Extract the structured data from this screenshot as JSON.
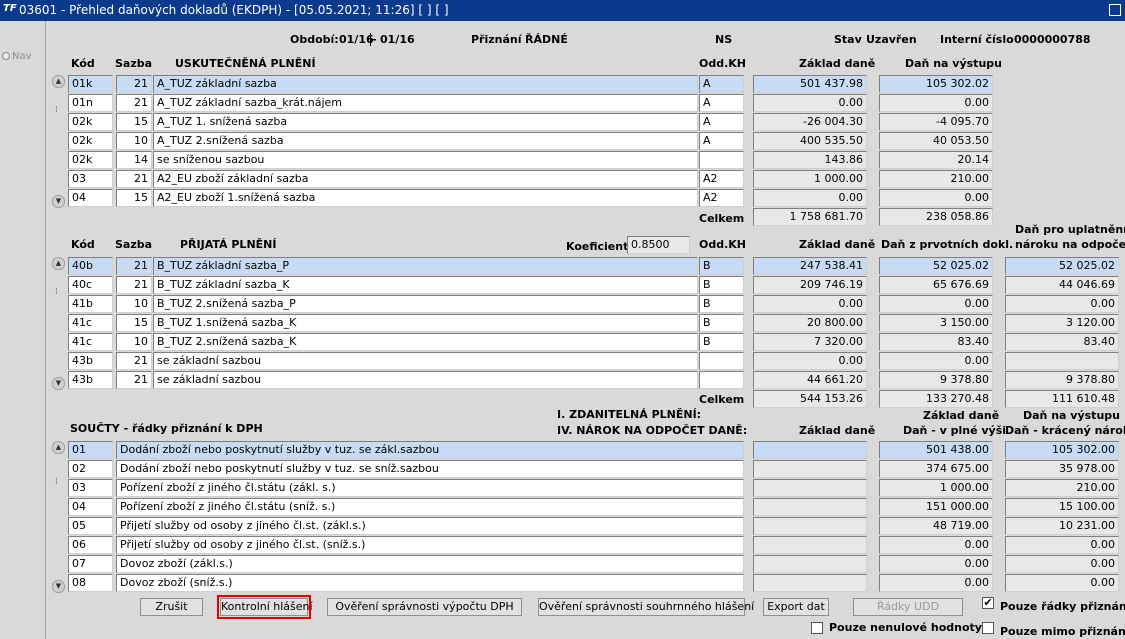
{
  "window": {
    "title": "03601 - Přehled daňových dokladů (EKDPH) - [05.05.2021; 11:26]  [ ]  [ ]",
    "logo": "TF"
  },
  "nav": {
    "label": "Nav"
  },
  "header": {
    "period_label": "Období:",
    "period_from": "01/16",
    "period_sep": "-",
    "period_to": "01/16",
    "filing_label": "Přiznání",
    "filing_value": "ŘÁDNÉ",
    "ns_label": "NS",
    "state_label": "Stav",
    "state_value": "Uzavřen",
    "internal_label": "Interní číslo",
    "internal_value": "0000000788"
  },
  "section1": {
    "col_kod": "Kód",
    "col_sazba": "Sazba",
    "col_name": "USKUTEČNĚNÁ PLNĚNÍ",
    "col_kh": "Odd.KH",
    "col_base": "Základ daně",
    "col_tax": "Daň na výstupu",
    "rows": [
      {
        "kod": "01k",
        "sazba": "21",
        "name": "A_TUZ základní sazba",
        "kh": "A",
        "base": "501 437.98",
        "tax": "105 302.02"
      },
      {
        "kod": "01n",
        "sazba": "21",
        "name": "A_TUZ základní sazba_krát.nájem",
        "kh": "A",
        "base": "0.00",
        "tax": "0.00"
      },
      {
        "kod": "02k",
        "sazba": "15",
        "name": "A_TUZ 1. snížená sazba",
        "kh": "A",
        "base": "-26 004.30",
        "tax": "-4 095.70"
      },
      {
        "kod": "02k",
        "sazba": "10",
        "name": "A_TUZ 2.snížená sazba",
        "kh": "A",
        "base": "400 535.50",
        "tax": "40 053.50"
      },
      {
        "kod": "02k",
        "sazba": "14",
        "name": "se sníženou sazbou",
        "kh": "",
        "base": "143.86",
        "tax": "20.14"
      },
      {
        "kod": "03",
        "sazba": "21",
        "name": "A2_EU zboží základní sazba",
        "kh": "A2",
        "base": "1 000.00",
        "tax": "210.00"
      },
      {
        "kod": "04",
        "sazba": "15",
        "name": "A2_EU zboží 1.snížená sazba",
        "kh": "A2",
        "base": "0.00",
        "tax": "0.00"
      }
    ],
    "total_label": "Celkem",
    "total_base": "1 758 681.70",
    "total_tax": "238 058.86"
  },
  "section2": {
    "col_kod": "Kód",
    "col_sazba": "Sazba",
    "col_name": "PŘIJATÁ PLNĚNÍ",
    "coef_label": "Koeficient",
    "coef_value": "0.8500",
    "col_kh": "Odd.KH",
    "col_base": "Základ daně",
    "col_tax": "Daň z prvotních dokl.",
    "col_claim_1": "Daň pro uplatnění",
    "col_claim_2": "nároku na odpočet",
    "rows": [
      {
        "kod": "40b",
        "sazba": "21",
        "name": "B_TUZ základní sazba_P",
        "kh": "B",
        "base": "247 538.41",
        "tax": "52 025.02",
        "claim": "52 025.02"
      },
      {
        "kod": "40c",
        "sazba": "21",
        "name": "B_TUZ základní sazba_K",
        "kh": "B",
        "base": "209 746.19",
        "tax": "65 676.69",
        "claim": "44 046.69"
      },
      {
        "kod": "41b",
        "sazba": "10",
        "name": "B_TUZ 2.snížená sazba_P",
        "kh": "B",
        "base": "0.00",
        "tax": "0.00",
        "claim": "0.00"
      },
      {
        "kod": "41c",
        "sazba": "15",
        "name": "B_TUZ 1.snížená sazba_K",
        "kh": "B",
        "base": "20 800.00",
        "tax": "3 150.00",
        "claim": "3 120.00"
      },
      {
        "kod": "41c",
        "sazba": "10",
        "name": "B_TUZ 2.snížená sazba_K",
        "kh": "B",
        "base": "7 320.00",
        "tax": "83.40",
        "claim": "83.40"
      },
      {
        "kod": "43b",
        "sazba": "21",
        "name": "se základní sazbou",
        "kh": "",
        "base": "0.00",
        "tax": "0.00",
        "claim": ""
      },
      {
        "kod": "43b",
        "sazba": "21",
        "name": "se základní sazbou",
        "kh": "",
        "base": "44 661.20",
        "tax": "9 378.80",
        "claim": "9 378.80"
      }
    ],
    "total_label": "Celkem",
    "total_base": "544 153.26",
    "total_tax": "133 270.48",
    "total_claim": "111 610.48"
  },
  "section3": {
    "title": "SOUČTY - řádky přiznání k DPH",
    "heading_1": "I. ZDANITELNÁ PLNĚNÍ:",
    "heading_2": "IV. NÁROK NA ODPOČET DANĚ:",
    "col_base": "Základ daně",
    "col_mid_1": "Základ daně",
    "col_mid_2": "Daň - v plné výši",
    "col_right_1": "Daň na výstupu",
    "col_right_2": "Daň - krácený nárok",
    "rows": [
      {
        "kod": "01",
        "name": "Dodání zboží nebo poskytnutí služby v tuz. se zákl.sazbou",
        "base": "",
        "mid": "501 438.00",
        "right": "105 302.00"
      },
      {
        "kod": "02",
        "name": "Dodání zboží nebo poskytnutí služby v tuz. se sníž.sazbou",
        "base": "",
        "mid": "374 675.00",
        "right": "35 978.00"
      },
      {
        "kod": "03",
        "name": "Pořízení zboží z jiného čl.státu (zákl. s.)",
        "base": "",
        "mid": "1 000.00",
        "right": "210.00"
      },
      {
        "kod": "04",
        "name": "Pořízení zboží z jiného čl.státu (sníž. s.)",
        "base": "",
        "mid": "151 000.00",
        "right": "15 100.00"
      },
      {
        "kod": "05",
        "name": "Přijetí služby od osoby z jiného čl.st. (zákl.s.)",
        "base": "",
        "mid": "48 719.00",
        "right": "10 231.00"
      },
      {
        "kod": "06",
        "name": "Přijetí služby od osoby z jiného čl.st. (sníž.s.)",
        "base": "",
        "mid": "0.00",
        "right": "0.00"
      },
      {
        "kod": "07",
        "name": "Dovoz zboží (zákl.s.)",
        "base": "",
        "mid": "0.00",
        "right": "0.00"
      },
      {
        "kod": "08",
        "name": "Dovoz zboží (sníž.s.)",
        "base": "",
        "mid": "0.00",
        "right": "0.00"
      }
    ]
  },
  "buttons": {
    "cancel": "Zrušit",
    "control_report": "Kontrolní hlášení",
    "verify_vat": "Ověření správnosti výpočtu DPH",
    "verify_summary": "Ověření správnosti souhrnného hlášení",
    "export": "Export dat",
    "rows_udd": "Řádky UDD"
  },
  "checkboxes": {
    "only_filing_rows": {
      "label": "Pouze řádky přiznání",
      "checked": "✔"
    },
    "only_nonzero": {
      "label": "Pouze nenulové hodnoty",
      "checked": ""
    },
    "only_outside": {
      "label": "Pouze mimo přiznání",
      "checked": ""
    }
  }
}
